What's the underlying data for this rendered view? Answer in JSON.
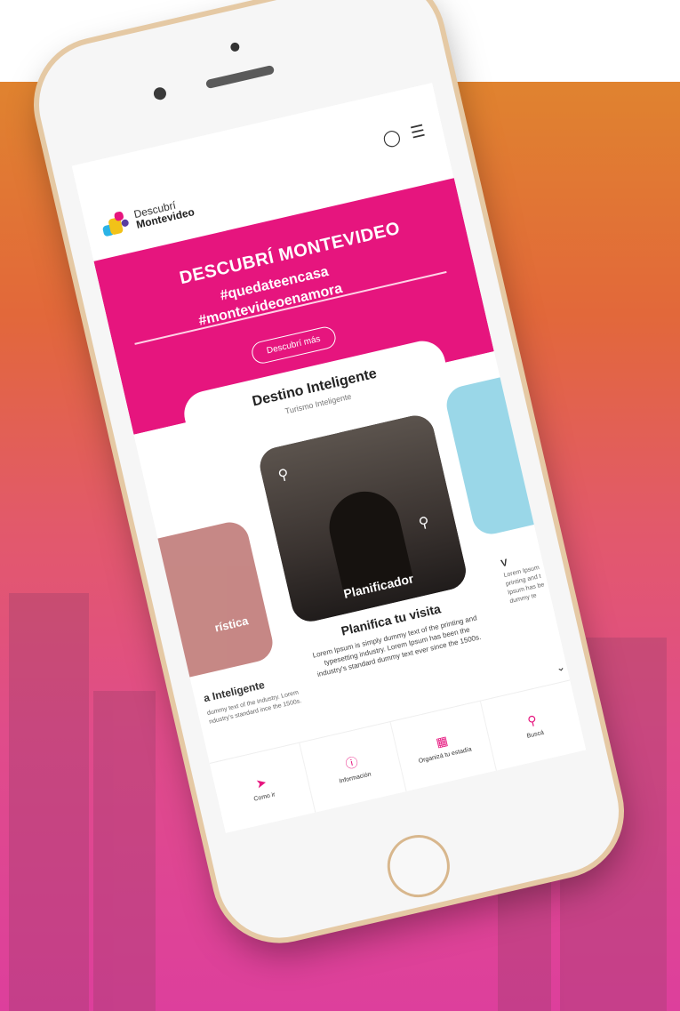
{
  "brand": {
    "line1": "Descubrí",
    "line2": "Montevideo"
  },
  "hero": {
    "title": "DESCUBRÍ MONTEVIDEO",
    "hashtag1": "#quedateencasa",
    "hashtag2": "#montevideoenamora",
    "button": "Descubrí más"
  },
  "section": {
    "title": "Destino Inteligente",
    "subtitle": "Turismo Inteligente"
  },
  "cards": {
    "main": {
      "label": "Planificador",
      "title": "Planifica tu visita",
      "text": "Lorem Ipsum is simply dummy text of the printing and typesetting industry. Lorem Ipsum has been the industry's standard dummy text ever since the 1500s."
    },
    "left": {
      "label": "rística",
      "title": "a Inteligente",
      "text": "dummy text of the industry. Lorem ndustry's standard ince the 1500s."
    },
    "right": {
      "title": "V",
      "text": "Lorem Ipsum printing and t Ipsum has be dummy te"
    }
  },
  "tabs": [
    {
      "label": "Como ir",
      "icon": "send-icon"
    },
    {
      "label": "Información",
      "icon": "info-icon"
    },
    {
      "label": "Organizá tu estadía",
      "icon": "calendar-icon"
    },
    {
      "label": "Buscá",
      "icon": "search-icon"
    }
  ],
  "colors": {
    "brand_pink": "#e6157e",
    "bg_top": "#e0832f",
    "bg_bottom": "#dd3f9c",
    "phone_frame": "#e5c9a4"
  }
}
